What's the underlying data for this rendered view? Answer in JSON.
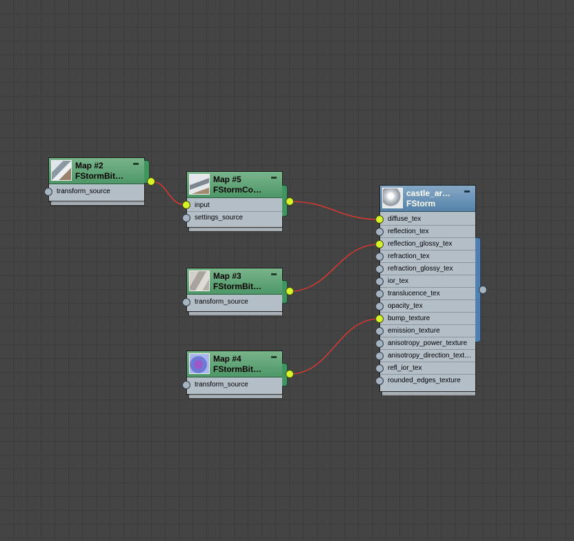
{
  "colors": {
    "canvas": "#444444",
    "wire": "#d23a32",
    "socket_connected": "#d6f32c",
    "socket_empty": "#a6b3c1",
    "map_header": "#4d9767",
    "material_header": "#5582a8",
    "node_body": "#b4bec6"
  },
  "nodes": {
    "map2": {
      "title": "Map #2",
      "subtitle": "FStormBit…",
      "icon": "bitmap-thumbnail",
      "inputs": [
        "transform_source"
      ]
    },
    "map5": {
      "title": "Map #5",
      "subtitle": "FStormCo…",
      "icon": "bitmap-thumbnail",
      "inputs": [
        "input",
        "settings_source"
      ]
    },
    "map3": {
      "title": "Map #3",
      "subtitle": "FStormBit…",
      "icon": "bitmap-thumbnail",
      "inputs": [
        "transform_source"
      ]
    },
    "map4": {
      "title": "Map #4",
      "subtitle": "FStormBit…",
      "icon": "bitmap-thumbnail",
      "inputs": [
        "transform_source"
      ]
    },
    "material": {
      "title": "castle_ar…",
      "subtitle": "FStorm",
      "icon": "material-sphere-thumbnail",
      "inputs": [
        "diffuse_tex",
        "reflection_tex",
        "reflection_glossy_tex",
        "refraction_tex",
        "refraction_glossy_tex",
        "ior_tex",
        "translucence_tex",
        "opacity_tex",
        "bump_texture",
        "emission_texture",
        "anisotropy_power_texture",
        "anisotropy_direction_text…",
        "refl_ior_tex",
        "rounded_edges_texture"
      ]
    }
  }
}
